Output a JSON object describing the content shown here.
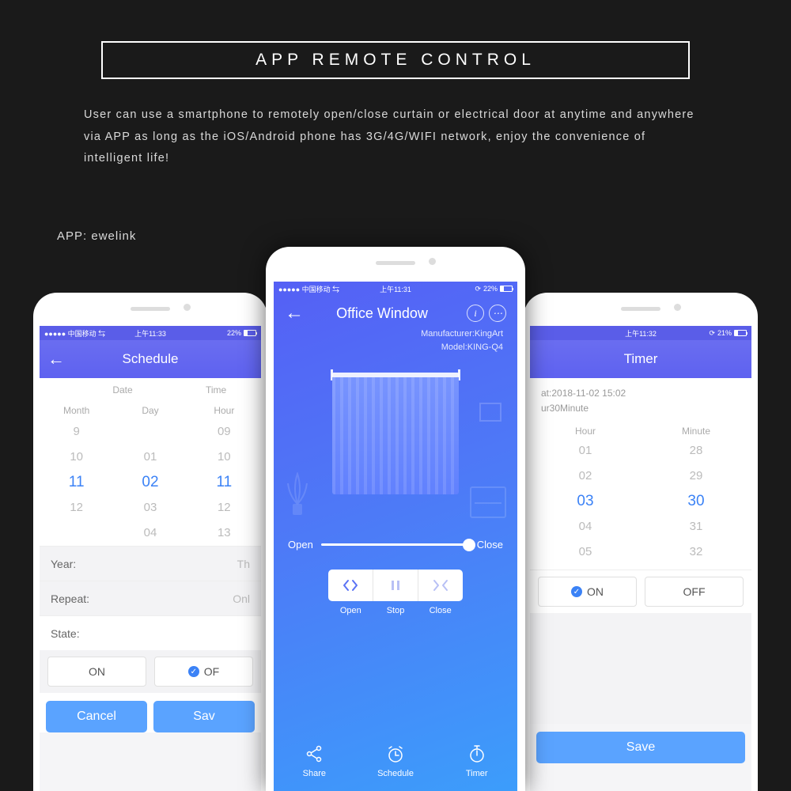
{
  "header": {
    "title": "APP REMOTE CONTROL"
  },
  "description": "User can use a smartphone to remotely open/close curtain or electrical door at anytime and anywhere via APP as long as the iOS/Android phone has 3G/4G/WIFI network, enjoy the convenience of intelligent life!",
  "app_label": "APP: ewelink",
  "status": {
    "carrier_left": "●●●●● 中国移动 ⇆",
    "carrier_center": "●●●●● 中国移动 ⇆",
    "time_left": "上午11:33",
    "time_center": "上午11:31",
    "time_right": "上午11:32",
    "batt_left": "22%",
    "batt_center": "22%",
    "batt_right": "21%"
  },
  "schedule": {
    "title": "Schedule",
    "date_label": "Date",
    "time_label": "Time",
    "cols": {
      "month": "Month",
      "day": "Day",
      "hour": "Hour"
    },
    "months": [
      "9",
      "10",
      "11",
      "12",
      ""
    ],
    "sel_month_idx": 2,
    "days": [
      "",
      "01",
      "02",
      "03",
      "04"
    ],
    "sel_day_idx": 2,
    "hours": [
      "09",
      "10",
      "11",
      "12",
      "13"
    ],
    "sel_hour_idx": 2,
    "year_label": "Year:",
    "year_val": "Th",
    "repeat_label": "Repeat:",
    "repeat_val": "Onl",
    "state_label": "State:",
    "on": "ON",
    "off": "OF",
    "cancel": "Cancel",
    "save": "Sav"
  },
  "device": {
    "title": "Office Window",
    "manufacturer": "Manufacturer:KingArt",
    "model": "Model:KING-Q4",
    "open": "Open",
    "close": "Close",
    "btn_open": "Open",
    "btn_stop": "Stop",
    "btn_close": "Close",
    "share": "Share",
    "schedule": "Schedule",
    "timer": "Timer"
  },
  "timer": {
    "title": "Timer",
    "info_line1": "at:2018-11-02 15:02",
    "info_line2": "ur30Minute",
    "hour_label": "Hour",
    "minute_label": "Minute",
    "hours": [
      "01",
      "02",
      "03",
      "04",
      "05"
    ],
    "sel_hour_idx": 2,
    "mins": [
      "28",
      "29",
      "30",
      "31",
      "32"
    ],
    "sel_min_idx": 2,
    "on": "ON",
    "off": "OFF",
    "save": "Save"
  }
}
